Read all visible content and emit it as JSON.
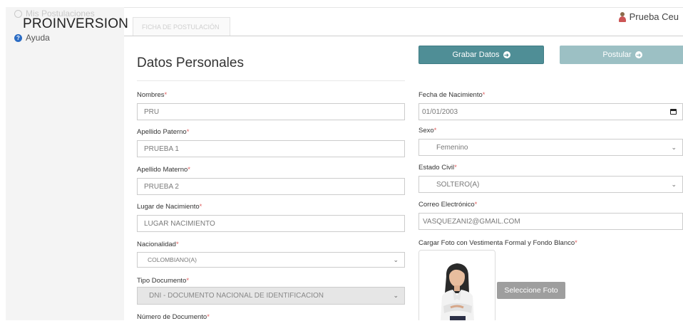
{
  "brand": "PROINVERSION",
  "sidebar": {
    "ghost_item": "Mis Postulaciones",
    "help_label": "Ayuda"
  },
  "tab": {
    "label": "FICHA DE POSTULACIÓN"
  },
  "user": {
    "name": "Prueba Ceu"
  },
  "section": {
    "title": "Datos Personales"
  },
  "buttons": {
    "save": "Grabar Datos",
    "apply": "Postular"
  },
  "form": {
    "nombres": {
      "label": "Nombres",
      "value": "PRU"
    },
    "apellido_paterno": {
      "label": "Apellido Paterno",
      "value": "PRUEBA 1"
    },
    "apellido_materno": {
      "label": "Apellido Materno",
      "value": "PRUEBA 2"
    },
    "lugar_nacimiento": {
      "label": "Lugar de Nacimiento",
      "value": "LUGAR NACIMIENTO"
    },
    "nacionalidad": {
      "label": "Nacionalidad",
      "value": "COLOMBIANO(A)"
    },
    "tipo_documento": {
      "label": "Tipo Documento",
      "value": "DNI - DOCUMENTO NACIONAL DE IDENTIFICACION"
    },
    "numero_documento": {
      "label": "Número de Documento"
    },
    "fecha_nacimiento": {
      "label": "Fecha de Nacimiento",
      "value": "01/01/2003"
    },
    "sexo": {
      "label": "Sexo",
      "value": "Femenino"
    },
    "estado_civil": {
      "label": "Estado Civil",
      "value": "SOLTERO(A)"
    },
    "correo": {
      "label": "Correo Electrónico",
      "value": "VASQUEZANI2@GMAIL.COM"
    },
    "foto": {
      "label": "Cargar Foto con Vestimenta Formal y Fondo Blanco",
      "button": "Seleccione Foto"
    }
  },
  "required_mark": "*",
  "colors": {
    "primary": "#4f8e96",
    "primary_disabled": "#9cc0c4",
    "required": "#e06060"
  }
}
